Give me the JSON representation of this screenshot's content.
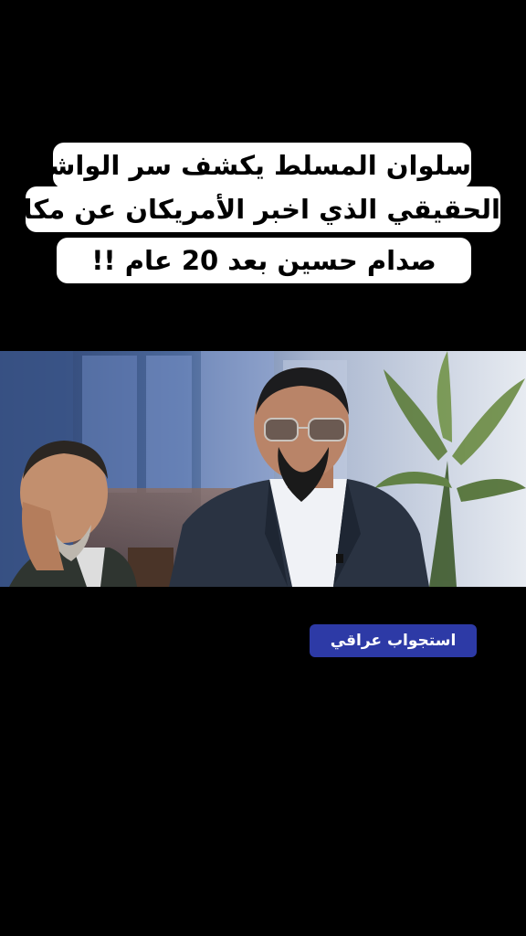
{
  "title": {
    "lines": [
      "سلوان المسلط يكشف سر الواشي",
      "الحقيقي الذي اخبر الأمريكان عن مكان",
      "صدام حسين بعد 20 عام !!"
    ]
  },
  "badge": {
    "label": "استجواب عراقي"
  },
  "colors": {
    "background": "#000000",
    "caption_bg": "#ffffff",
    "badge_bg": "#2d3aa6"
  }
}
